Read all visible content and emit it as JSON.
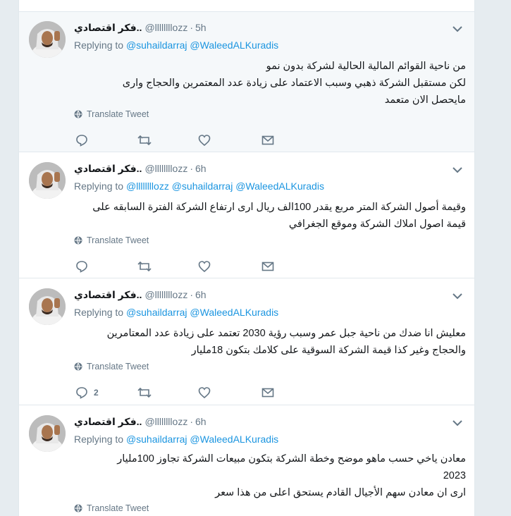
{
  "tweets": [
    {
      "name": "فكر اقتصادي..",
      "handle": "@llllllllozz",
      "time": "5h",
      "replying_label": "Replying to",
      "mentions": [
        "@suhaildarraj",
        "@WaleedALKuradis"
      ],
      "lines": [
        "من ناحية القوائم المالية الحالية لشركة بدون نمو",
        "لكن مستقبل الشركة ذهبي وسبب الاعتماد على زيادة عدد المعتمرين والحجاج وارى",
        "مايحصل الان متعمد"
      ],
      "translate": "Translate Tweet",
      "reply_count": ""
    },
    {
      "name": "فكر اقتصادي..",
      "handle": "@llllllllozz",
      "time": "6h",
      "replying_label": "Replying to",
      "mentions": [
        "@llllllllozz",
        "@suhaildarraj",
        "@WaleedALKuradis"
      ],
      "lines": [
        "وقيمة أصول الشركة المتر مربع يقدر 100الف ريال ارى ارتفاع الشركة الفترة السابقه على",
        "قيمة اصول املاك الشركة وموقع الجغرافي"
      ],
      "translate": "Translate Tweet",
      "reply_count": ""
    },
    {
      "name": "فكر اقتصادي..",
      "handle": "@llllllllozz",
      "time": "6h",
      "replying_label": "Replying to",
      "mentions": [
        "@suhaildarraj",
        "@WaleedALKuradis"
      ],
      "lines": [
        "معليش انا ضدك من ناحية جبل عمر وسبب رؤية 2030 تعتمد على زيادة عدد المعتامرين",
        "والحجاج وغير كذا قيمة الشركة السوقية على كلامك بتكون 18مليار"
      ],
      "translate": "Translate Tweet",
      "reply_count": "2"
    },
    {
      "name": "فكر اقتصادي..",
      "handle": "@llllllllozz",
      "time": "6h",
      "replying_label": "Replying to",
      "mentions": [
        "@suhaildarraj",
        "@WaleedALKuradis"
      ],
      "lines": [
        "معادن ياخي حسب ماهو موضح وخطة الشركة بتكون مبيعات الشركة تجاوز 100مليار",
        "2023",
        "ارى ان معادن سهم الأجيال القادم يستحق اعلى من هذا سعر"
      ],
      "translate": "Translate Tweet",
      "reply_count": ""
    }
  ],
  "icons": {
    "reply": "reply-icon",
    "retweet": "retweet-icon",
    "like": "heart-icon",
    "dm": "envelope-icon",
    "translate": "globe-icon",
    "caret": "chevron-down-icon"
  },
  "colors": {
    "link": "#1b95e0",
    "muted": "#657786",
    "text": "#14171a",
    "highlight_bg": "#f5f8fa"
  }
}
